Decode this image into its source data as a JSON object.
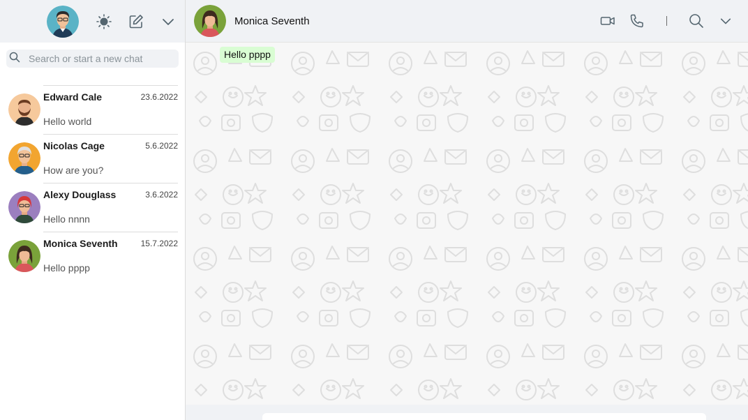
{
  "search": {
    "placeholder": "Search or start a new chat"
  },
  "sidebar_header": {
    "icons": [
      "profile-avatar",
      "status-sun-icon",
      "new-chat-icon",
      "chevron-down-icon"
    ]
  },
  "chats": [
    {
      "name": "Edward Cale",
      "date": "23.6.2022",
      "preview": "Hello world"
    },
    {
      "name": "Nicolas Cage",
      "date": "5.6.2022",
      "preview": "How are you?"
    },
    {
      "name": "Alexy Douglass",
      "date": "3.6.2022",
      "preview": "Hello nnnn"
    },
    {
      "name": "Monica Seventh",
      "date": "15.7.2022",
      "preview": "Hello pppp"
    }
  ],
  "conversation": {
    "contact_name": "Monica Seventh",
    "messages": [
      {
        "text": "Hello pppp"
      }
    ],
    "actions": [
      "video-call-icon",
      "voice-call-icon",
      "search-icon",
      "chevron-down-icon"
    ]
  },
  "colors": {
    "header_bg": "#f0f2f5",
    "message_bubble": "#d9fdd3",
    "conversation_bg": "#efeae2"
  }
}
